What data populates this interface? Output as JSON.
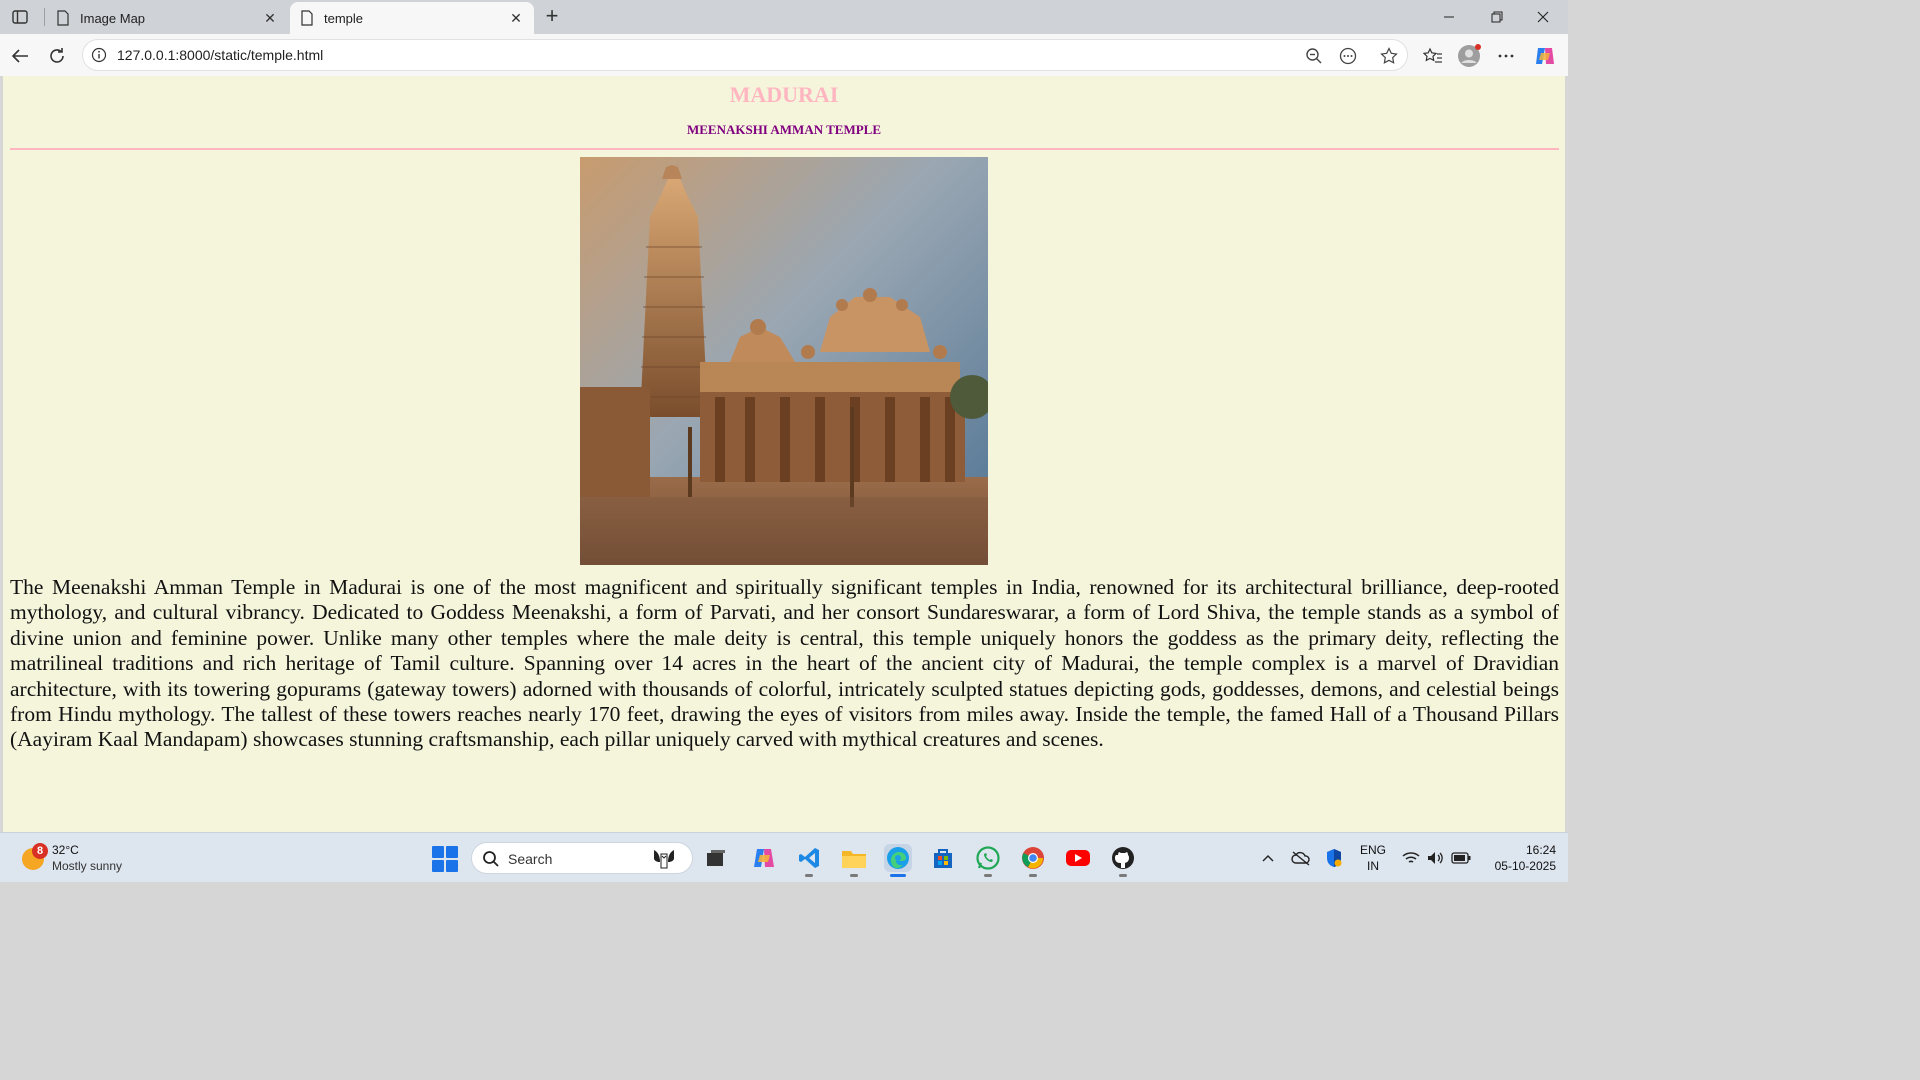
{
  "browser": {
    "tabs": [
      {
        "title": "Image Map",
        "active": false
      },
      {
        "title": "temple",
        "active": true
      }
    ],
    "address_url": "127.0.0.1:8000/static/temple.html"
  },
  "page": {
    "heading": "MADURAI",
    "subheading": "MEENAKSHI AMMAN TEMPLE",
    "image_subject": "Meenakshi Amman Temple gopuram and mandapam at sunset",
    "description": "The Meenakshi Amman Temple in Madurai is one of the most magnificent and spiritually significant temples in India, renowned for its architectural brilliance, deep-rooted mythology, and cultural vibrancy. Dedicated to Goddess Meenakshi, a form of Parvati, and her consort Sundareswarar, a form of Lord Shiva, the temple stands as a symbol of divine union and feminine power. Unlike many other temples where the male deity is central, this temple uniquely honors the goddess as the primary deity, reflecting the matrilineal traditions and rich heritage of Tamil culture. Spanning over 14 acres in the heart of the ancient city of Madurai, the temple complex is a marvel of Dravidian architecture, with its towering gopurams (gateway towers) adorned with thousands of colorful, intricately sculpted statues depicting gods, goddesses, demons, and celestial beings from Hindu mythology. The tallest of these towers reaches nearly 170 feet, drawing the eyes of visitors from miles away. Inside the temple, the famed Hall of a Thousand Pillars (Aayiram Kaal Mandapam) showcases stunning craftsmanship, each pillar uniquely carved with mythical creatures and scenes.",
    "colors": {
      "background": "#f5f5dc",
      "heading": "#ffb6c1",
      "subheading": "#800080",
      "rule": "#ffb6c1"
    }
  },
  "taskbar": {
    "weather": {
      "badge": "8",
      "temp": "32°C",
      "condition": "Mostly sunny"
    },
    "search_label": "Search",
    "apps": [
      "copilot-icon",
      "task-view-icon",
      "copilot-app-icon",
      "vscode-icon",
      "file-explorer-icon",
      "edge-icon",
      "store-icon",
      "whatsapp-icon",
      "chrome-icon",
      "youtube-icon",
      "github-icon"
    ],
    "lang_primary": "ENG",
    "lang_secondary": "IN",
    "time": "16:24",
    "date": "05-10-2025"
  }
}
